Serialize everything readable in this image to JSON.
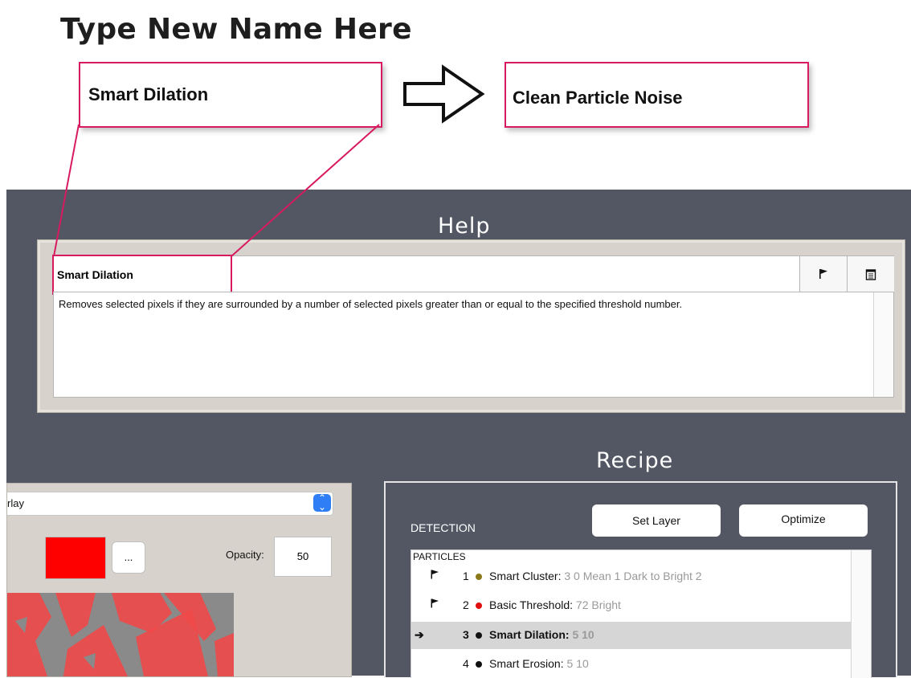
{
  "annotation": {
    "title": "Type New Name Here",
    "old_name": "Smart Dilation",
    "new_name": "Clean Particle Noise",
    "accent_color": "#d81b60"
  },
  "help": {
    "title": "Help",
    "step_name": "Smart Dilation",
    "description": "Removes selected pixels if they are surrounded by a number of selected pixels greater than or equal to the specified threshold number.",
    "flag_icon": "flag-icon",
    "notes_icon": "notes-icon"
  },
  "overlay": {
    "select_value": "rlay",
    "color": "#ff0000",
    "dots_label": "...",
    "opacity_label": "Opacity:",
    "opacity_value": "50"
  },
  "recipe": {
    "title": "Recipe",
    "detection_label": "DETECTION",
    "set_layer_label": "Set Layer",
    "optimize_label": "Optimize",
    "group_label": "PARTICLES",
    "steps": [
      {
        "num": "1",
        "name": "Smart Cluster:",
        "params": "3 0 Mean 1 Dark to Bright 2",
        "dot_color": "#8b7a1a",
        "flag": true,
        "selected": false
      },
      {
        "num": "2",
        "name": "Basic Threshold:",
        "params": "72 Bright",
        "dot_color": "#e01010",
        "flag": true,
        "selected": false
      },
      {
        "num": "3",
        "name": "Smart Dilation:",
        "params": "5 10",
        "dot_color": "#111111",
        "flag": false,
        "selected": true,
        "marker": "➔"
      },
      {
        "num": "4",
        "name": "Smart Erosion:",
        "params": "5 10",
        "dot_color": "#111111",
        "flag": false,
        "selected": false
      }
    ]
  }
}
